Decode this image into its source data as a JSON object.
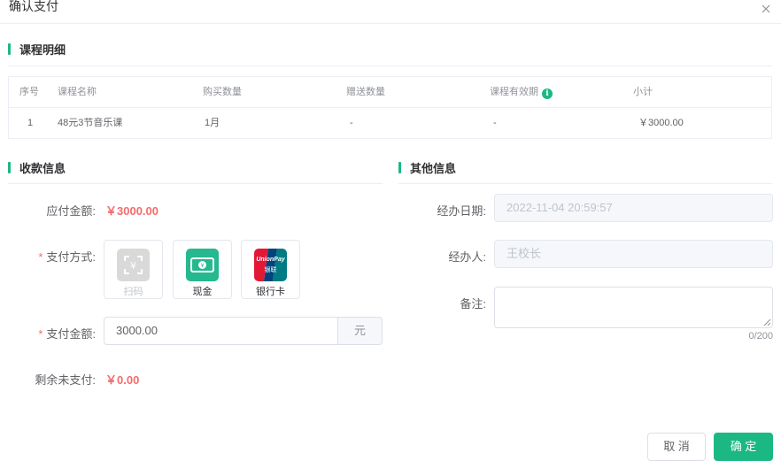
{
  "dialog": {
    "title": "确认支付"
  },
  "course_section": {
    "title": "课程明细"
  },
  "table": {
    "headers": [
      "序号",
      "课程名称",
      "购买数量",
      "赠送数量",
      "课程有效期",
      "小计"
    ],
    "rows": [
      [
        "1",
        "48元3节音乐课",
        "1月",
        "-",
        "-",
        "￥3000.00"
      ]
    ]
  },
  "payment_section": {
    "title": "收款信息",
    "amount_due_label": "应付金额:",
    "amount_due_value": "￥3000.00",
    "method_label": "支付方式:",
    "methods": [
      {
        "label": "扫码",
        "icon": "qr-scan-icon",
        "enabled": false
      },
      {
        "label": "现金",
        "icon": "cash-icon",
        "enabled": true
      },
      {
        "label": "银行卡",
        "icon": "unionpay-icon",
        "enabled": true
      }
    ],
    "unionpay_text": "UnionPay",
    "unionpay_cn": "银联",
    "pay_amount_label": "支付金额:",
    "pay_amount_value": "3000.00",
    "pay_amount_unit": "元",
    "remaining_label": "剩余未支付:",
    "remaining_value": "￥0.00"
  },
  "other_section": {
    "title": "其他信息",
    "date_label": "经办日期:",
    "date_value": "2022-11-04 20:59:57",
    "handler_label": "经办人:",
    "handler_value": "王校长",
    "remark_label": "备注:",
    "remark_value": "",
    "remark_counter": "0/200"
  },
  "footer": {
    "cancel_label": "取 消",
    "confirm_label": "确 定"
  },
  "colors": {
    "accent": "#1cb883",
    "danger": "#f56c6c",
    "border": "#dcdfe6",
    "disabled_bg": "#f5f7fa",
    "cash_green": "#26b88e"
  }
}
